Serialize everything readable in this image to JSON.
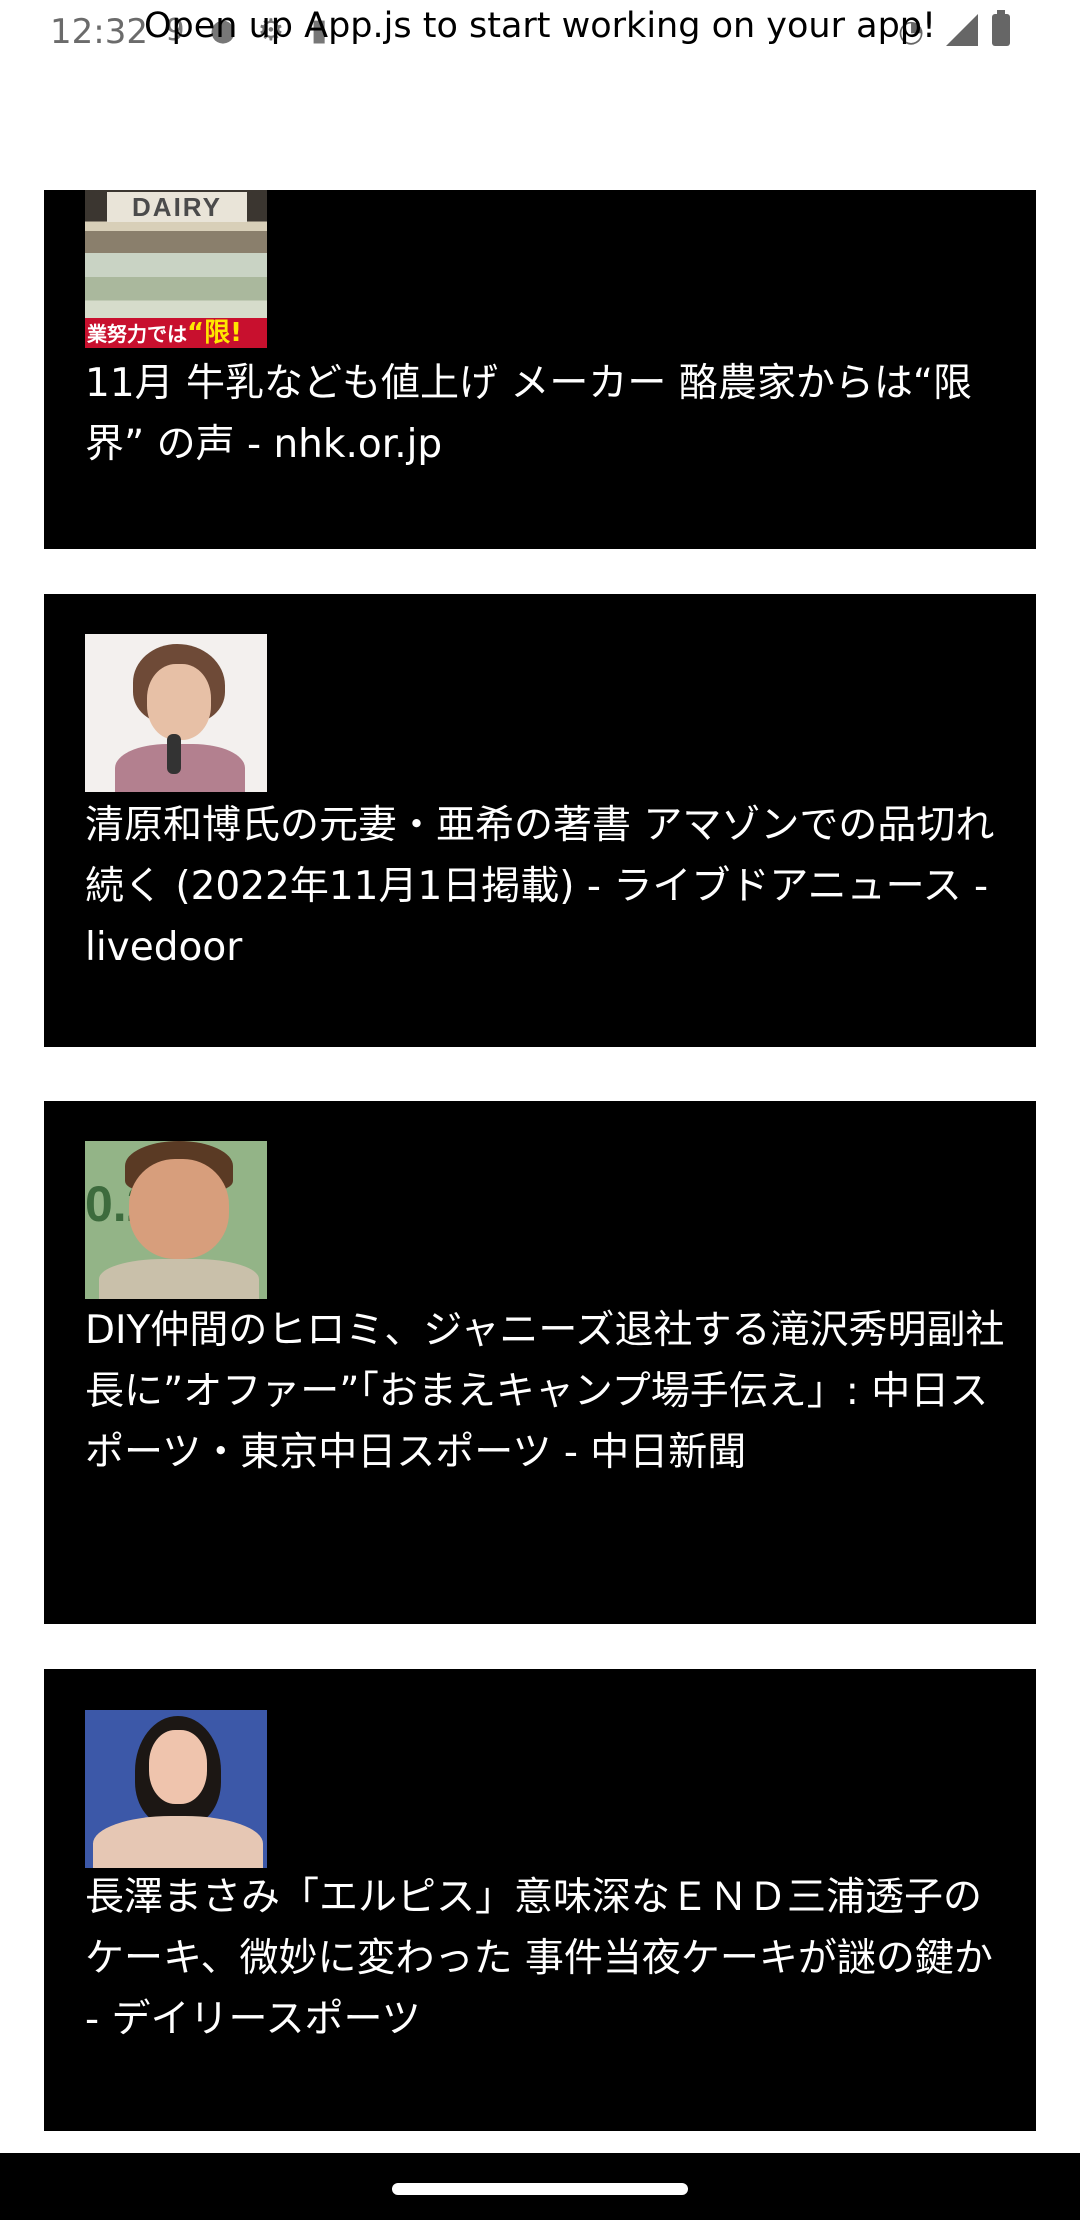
{
  "status_bar": {
    "time": "12:32",
    "notification_badge": "9"
  },
  "header": {
    "message": "Open up App.js to start working on your app!"
  },
  "news": [
    {
      "title": "11月 牛乳なども値上げ メーカー 酪農家からは“限界” の声 - nhk.or.jp",
      "thumb_sign": "DAIRY",
      "thumb_banner_prefix": "業努力では",
      "thumb_banner_emphasis": "“限!"
    },
    {
      "title": "清原和博氏の元妻・亜希の著書 アマゾンでの品切れ続く (2022年11月1日掲載) - ライブドアニュース - livedoor"
    },
    {
      "title": "DIY仲間のヒロミ、ジャニーズ退社する滝沢秀明副社長に”オファー”「おまえキャンプ場手伝え」: 中日スポーツ・東京中日スポーツ - 中日新聞",
      "thumb_bg_text": "0.2"
    },
    {
      "title": "長澤まさみ「エルピス」意味深なＥＮＤ三浦透子のケーキ、微妙に変わった 事件当夜ケーキが謎の鍵か - デイリースポーツ"
    }
  ]
}
